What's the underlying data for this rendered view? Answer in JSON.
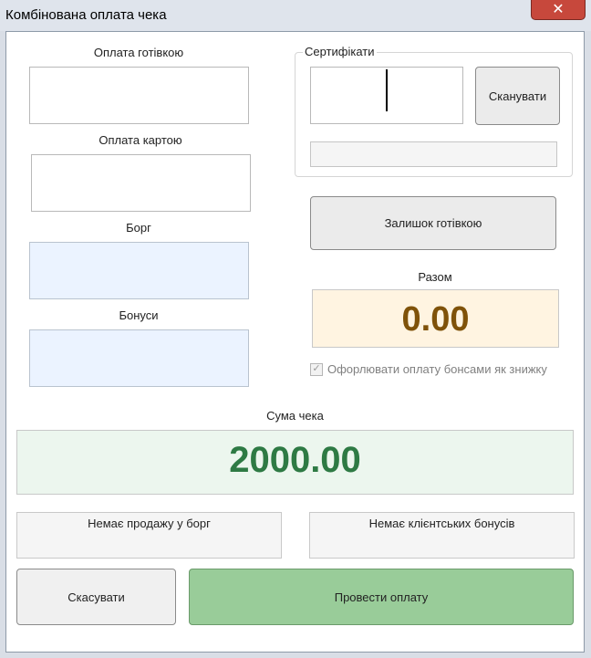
{
  "window": {
    "title": "Комбінована оплата чека",
    "close_glyph": "✕"
  },
  "cash": {
    "label": "Оплата готівкою",
    "value": ""
  },
  "card": {
    "label": "Оплата картою",
    "value": ""
  },
  "debt": {
    "label": "Борг",
    "value": ""
  },
  "bonuses": {
    "label": "Бонуси",
    "value": ""
  },
  "certificates": {
    "group_label": "Сертифікати",
    "code_value": "",
    "scan_label": "Сканувати",
    "list_value": ""
  },
  "cash_remainder": {
    "label": "Залишок готівкою"
  },
  "total": {
    "label": "Разом",
    "value": "0.00",
    "color": "#7f5209",
    "bg": "#fff4e1"
  },
  "discount_checkbox": {
    "label": "Офорлювати оплату бонсами як знижку",
    "checked": true
  },
  "receipt_sum": {
    "label": "Сума чека",
    "value": "2000.00",
    "color": "#2e7a44",
    "bg": "#ecf6ee"
  },
  "no_debt_info": "Немає продажу у борг",
  "no_bonus_info": "Немає клієнтських бонусів",
  "cancel_button": "Скасувати",
  "pay_button": {
    "label": "Провести оплату",
    "bg": "#99cc99"
  }
}
